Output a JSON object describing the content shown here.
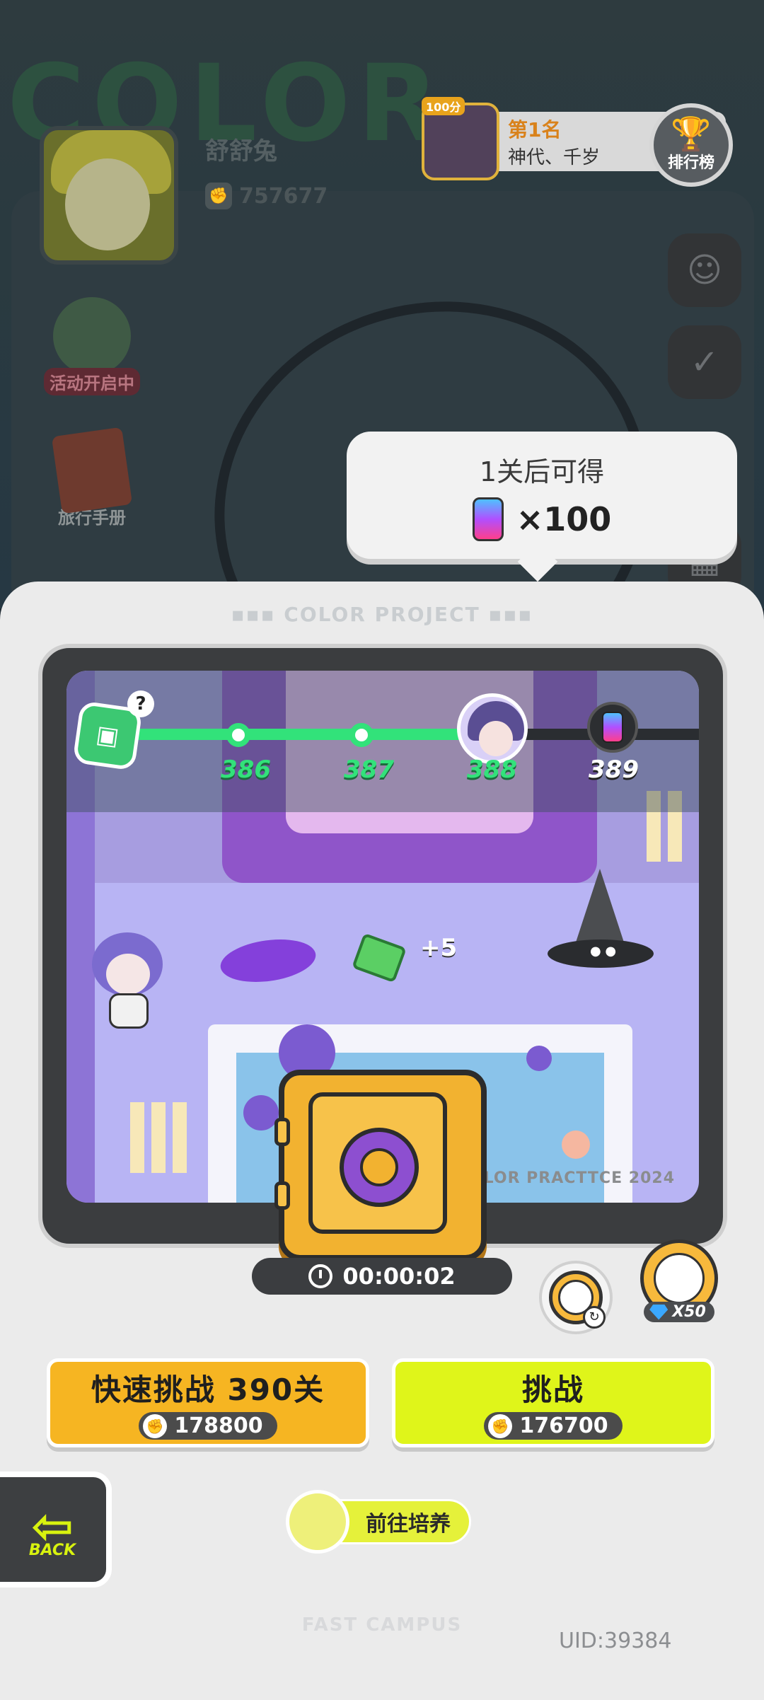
{
  "player": {
    "name": "舒舒兔",
    "power": "757677"
  },
  "leaderboard": {
    "top_score_badge": "100分",
    "rank_label": "第1名",
    "rank_name": "神代、千岁",
    "button_label": "排行榜"
  },
  "left_menu": {
    "event_label": "活动开启中",
    "journal_label": "旅行手册"
  },
  "reward_bubble": {
    "title": "1关后可得",
    "amount": "×100"
  },
  "panel": {
    "header": "▪▪▪ COLOR PROJECT ▪▪▪",
    "watermark": "COLOR PRACTTCE 2024"
  },
  "level_progress": {
    "levels": [
      "386",
      "387",
      "388",
      "389"
    ],
    "current_level": "388",
    "help_mark": "?"
  },
  "scene": {
    "plus_text": "+5"
  },
  "timer": "00:00:02",
  "boost": {
    "gem_cost": "X50"
  },
  "buttons": {
    "quick": {
      "label": "快速挑战 390关",
      "cost": "178800"
    },
    "challenge": {
      "label": "挑战",
      "cost": "176700"
    },
    "back": "BACK",
    "train": "前往培养"
  },
  "footer": {
    "logo": "FAST CAMPUS",
    "uid": "UID:39384"
  },
  "colors": {
    "accent_yellow": "#f6b522",
    "accent_lime": "#dff51a",
    "progress_green": "#32e27a"
  }
}
